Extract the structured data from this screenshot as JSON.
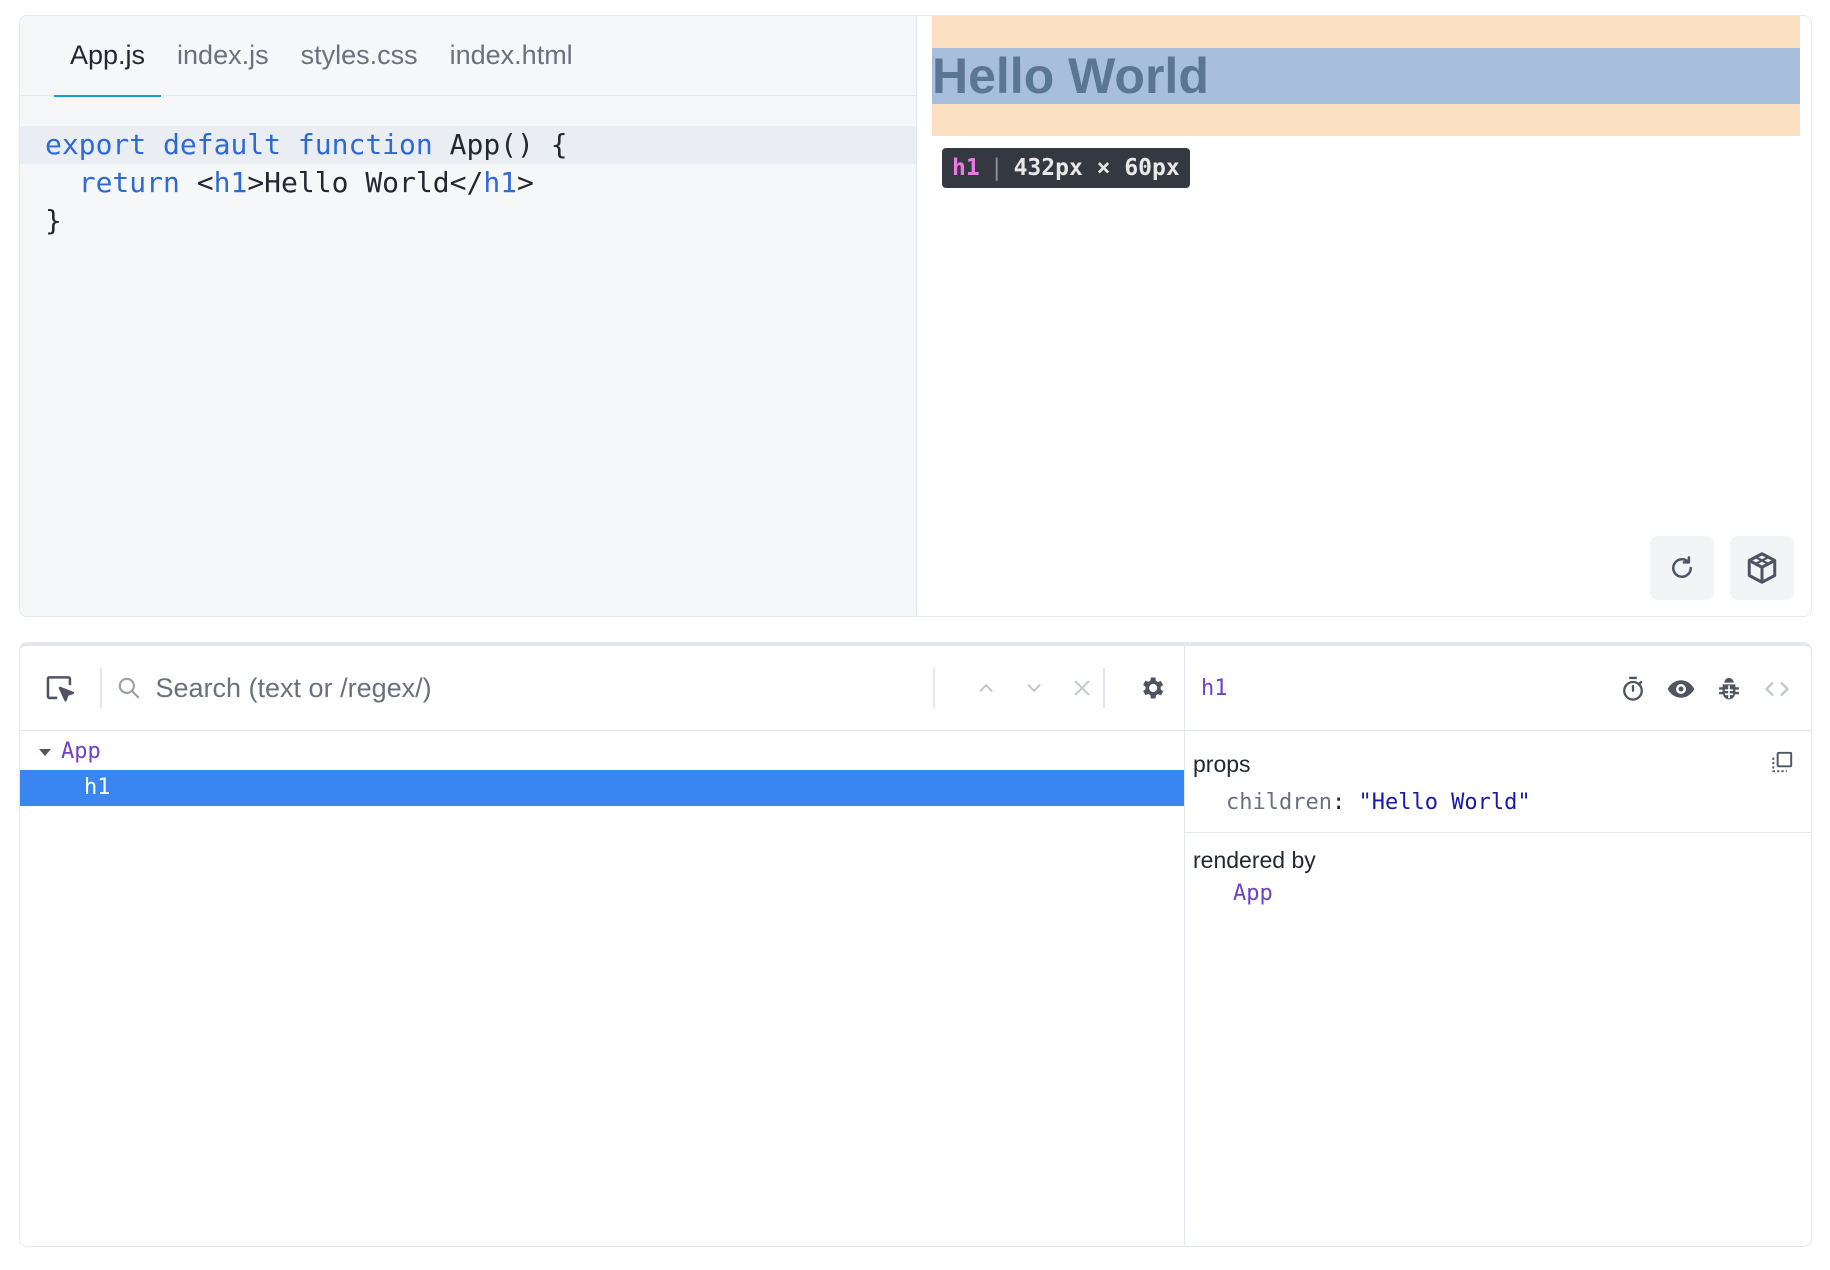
{
  "editor": {
    "tabs": [
      {
        "label": "App.js",
        "active": true
      },
      {
        "label": "index.js"
      },
      {
        "label": "styles.css"
      },
      {
        "label": "index.html"
      }
    ],
    "code": {
      "line1": {
        "kw1": "export",
        "kw2": "default",
        "kw3": "function",
        "rest": "App() {"
      },
      "line2": {
        "kw": "return",
        "open_lt": "<",
        "open_tag": "h1",
        "gt_text": ">Hello World</",
        "close_tag": "h1",
        "close_gt": ">"
      },
      "line3": "}"
    }
  },
  "preview": {
    "heading": "Hello World",
    "size_tip": {
      "tag": "h1",
      "sep": "|",
      "size": "432px × 60px"
    },
    "buttons": {
      "refresh_icon": "refresh-icon",
      "sandbox_icon": "codesandbox-icon"
    }
  },
  "devtools": {
    "search": {
      "placeholder": "Search (text or /regex/)"
    },
    "tree": [
      {
        "name": "App",
        "expanded": true,
        "depth": 0
      },
      {
        "name": "h1",
        "selected": true,
        "depth": 1
      }
    ],
    "inspector": {
      "component": "h1",
      "props_title": "props",
      "prop": {
        "key": "children",
        "colon": ":",
        "value": "\"Hello World\""
      },
      "rendered_by_title": "rendered by",
      "rendered_by": "App"
    },
    "colors": {
      "selection": "#3a86f0",
      "component": "#6f42c1",
      "string": "#1a1aa6"
    }
  }
}
